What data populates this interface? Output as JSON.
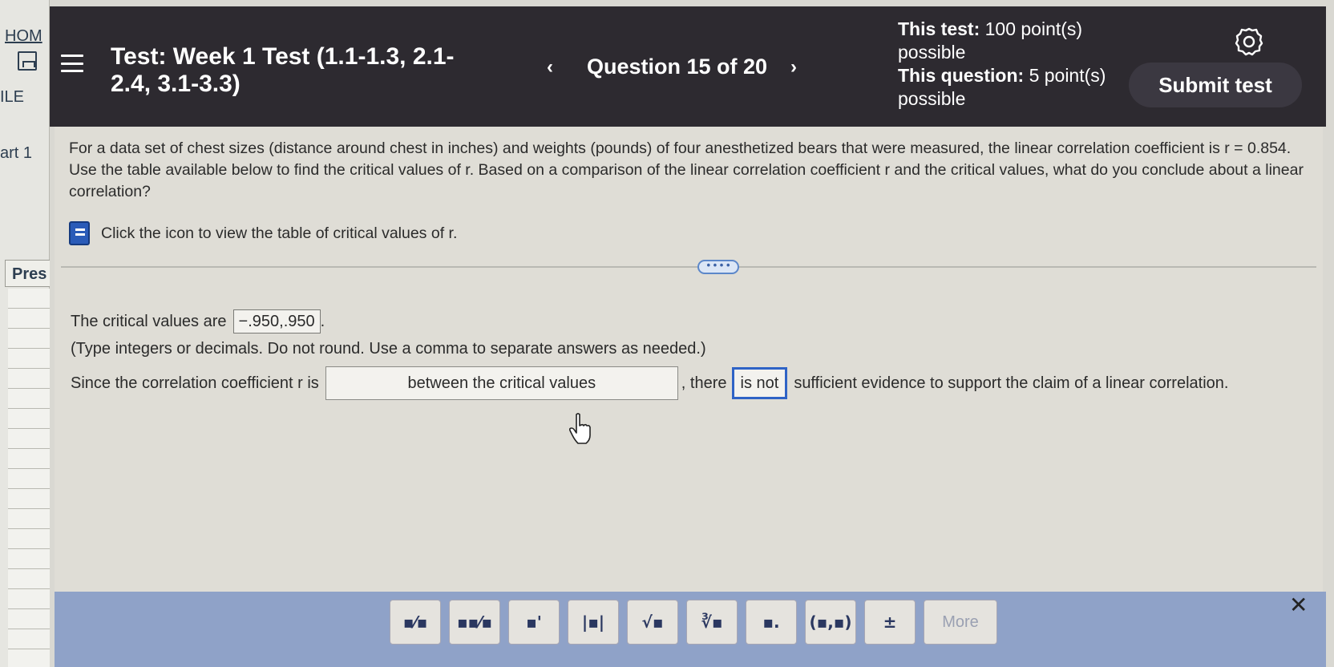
{
  "sidebar": {
    "home_label": "HOM",
    "file_label": "ILE",
    "chart_label": "art 1",
    "pres_label": "Pres"
  },
  "header": {
    "title": "Test: Week 1 Test (1.1-1.3, 2.1-2.4, 3.1-3.3)",
    "prev": "‹",
    "question_label": "Question 15 of 20",
    "next": "›",
    "test_points_label": "This test:",
    "test_points_value": "100 point(s) possible",
    "question_points_label": "This question:",
    "question_points_value": "5 point(s) possible",
    "submit_label": "Submit test",
    "settings_icon": "gear-icon"
  },
  "question": {
    "text": "For a data set of chest sizes (distance around chest in inches) and weights (pounds) of four anesthetized bears that were measured, the linear correlation coefficient is r = 0.854. Use the table available below to find the critical values of r. Based on a comparison of the linear correlation coefficient r and the critical values, what do you conclude about a linear correlation?",
    "table_link": "Click the icon to view the table of critical values of r.",
    "table_icon": "book-icon"
  },
  "expand_handle": "• • • •",
  "answers": {
    "critical_prefix": "The critical values are",
    "critical_value": "−.950,.950",
    "critical_suffix": ".",
    "hint": "(Type integers or decimals. Do not round. Use a comma to separate answers as needed.)",
    "since_prefix": "Since the correlation coefficient r is",
    "dropdown_1_value": "between the critical values",
    "middle_text": ", there",
    "dropdown_2_value": "is not",
    "since_suffix": "sufficient evidence to support the claim of a linear correlation."
  },
  "toolbar": {
    "buttons": [
      {
        "name": "fraction",
        "glyph": "▪⁄▪"
      },
      {
        "name": "mixed-number",
        "glyph": "▪▪⁄▪"
      },
      {
        "name": "exponent",
        "glyph": "▪'"
      },
      {
        "name": "absolute-value",
        "glyph": "|▪|"
      },
      {
        "name": "square-root",
        "glyph": "√▪"
      },
      {
        "name": "nth-root",
        "glyph": "∛▪"
      },
      {
        "name": "decimal",
        "glyph": "▪."
      },
      {
        "name": "ordered-pair",
        "glyph": "(▪,▪)"
      },
      {
        "name": "plus-minus",
        "glyph": "±"
      }
    ],
    "more_label": "More",
    "close_icon": "close-icon"
  }
}
